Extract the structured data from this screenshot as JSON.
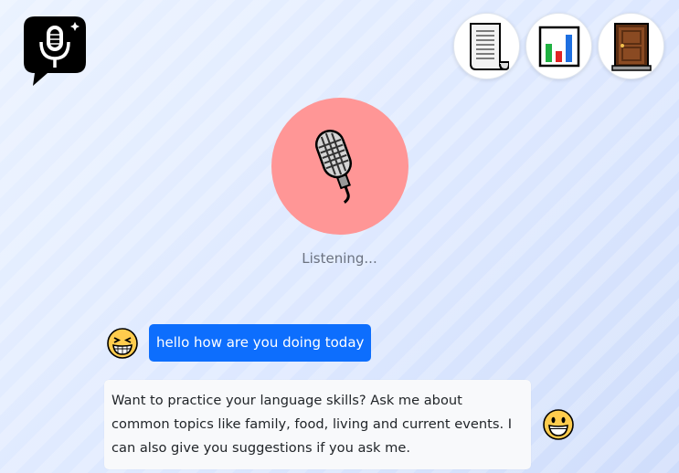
{
  "app": {
    "logo_icon": "podcast-mic-chat-logo",
    "accent": "#0d6efd",
    "mic_bg": "#ff9696"
  },
  "toolbar": {
    "buttons": [
      {
        "name": "transcript",
        "icon": "scroll-page-icon"
      },
      {
        "name": "stats",
        "icon": "bar-chart-icon"
      },
      {
        "name": "exit",
        "icon": "door-icon"
      }
    ]
  },
  "mic": {
    "icon": "studio-microphone-icon",
    "status": "Listening..."
  },
  "conversation": {
    "messages": [
      {
        "role": "user",
        "avatar": "grinning-squinting-face-icon",
        "text": "hello how are you doing today"
      },
      {
        "role": "assistant",
        "avatar": "grinning-face-icon",
        "text": "Want to practice your language skills? Ask me about common topics like family, food, living and current events. I can also give you suggestions if you ask me."
      }
    ]
  }
}
